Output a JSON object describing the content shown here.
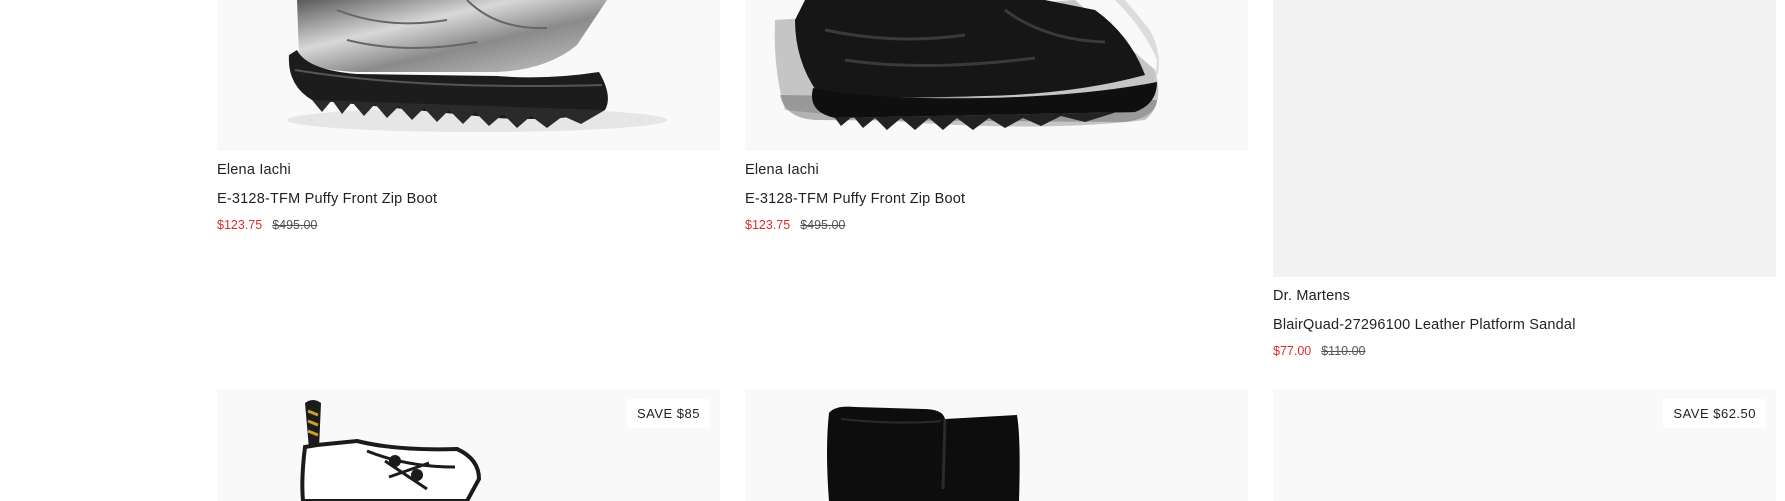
{
  "products_row1": [
    {
      "brand": "Elena Iachi",
      "title": "E-3128-TFM Puffy Front Zip Boot",
      "sale_price": "$123.75",
      "original_price": "$495.00",
      "image_icon": "silver-puffy-boot-image"
    },
    {
      "brand": "Elena Iachi",
      "title": "E-3128-TFM Puffy Front Zip Boot",
      "sale_price": "$123.75",
      "original_price": "$495.00",
      "image_icon": "black-puffy-boot-image"
    },
    {
      "brand": "Dr. Martens",
      "title": "BlairQuad-27296100 Leather Platform Sandal",
      "sale_price": "$77.00",
      "original_price": "$110.00",
      "image_icon": "image-placeholder"
    }
  ],
  "products_row2": [
    {
      "badge": "SAVE $85",
      "image_icon": "white-lace-up-boot-image"
    },
    {
      "badge": "",
      "image_icon": "black-suede-boot-image"
    },
    {
      "badge": "SAVE $62.50",
      "image_icon": "image-placeholder"
    }
  ],
  "colors": {
    "sale_price": "#e02b2b",
    "image_background": "#f9f9f9",
    "placeholder_background": "#f2f2f2"
  }
}
